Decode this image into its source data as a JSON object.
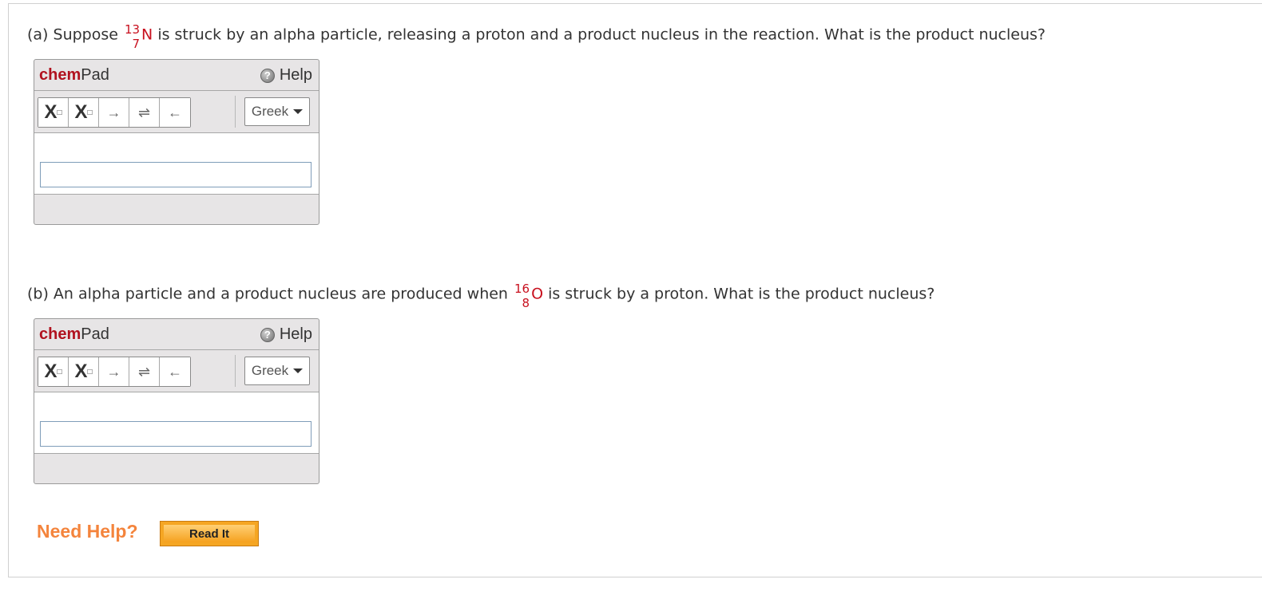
{
  "part_a": {
    "prefix": "(a) Suppose",
    "nuclide": {
      "mass": "13",
      "atomic": "7",
      "symbol": "N"
    },
    "suffix": "is struck by an alpha particle, releasing a proton and a product nucleus in the reaction. What is the product nucleus?"
  },
  "part_b": {
    "prefix": "(b) An alpha particle and a product nucleus are produced when",
    "nuclide": {
      "mass": "16",
      "atomic": "8",
      "symbol": "O"
    },
    "suffix": "is struck by a proton. What is the product nucleus?"
  },
  "chempad": {
    "title_bold": "chem",
    "title_rest": "Pad",
    "help_label": "Help",
    "subscript_label": "X",
    "superscript_label": "X",
    "arrow_right": "→",
    "arrow_equilibrium": "⇌",
    "arrow_left": "←",
    "greek_label": "Greek"
  },
  "need_help": {
    "label": "Need Help?",
    "read_it": "Read It"
  },
  "colors": {
    "nuclide": "#c8101e",
    "chem_brand": "#b1121f",
    "need_help": "#f4843c",
    "read_it": "#f5a623"
  }
}
